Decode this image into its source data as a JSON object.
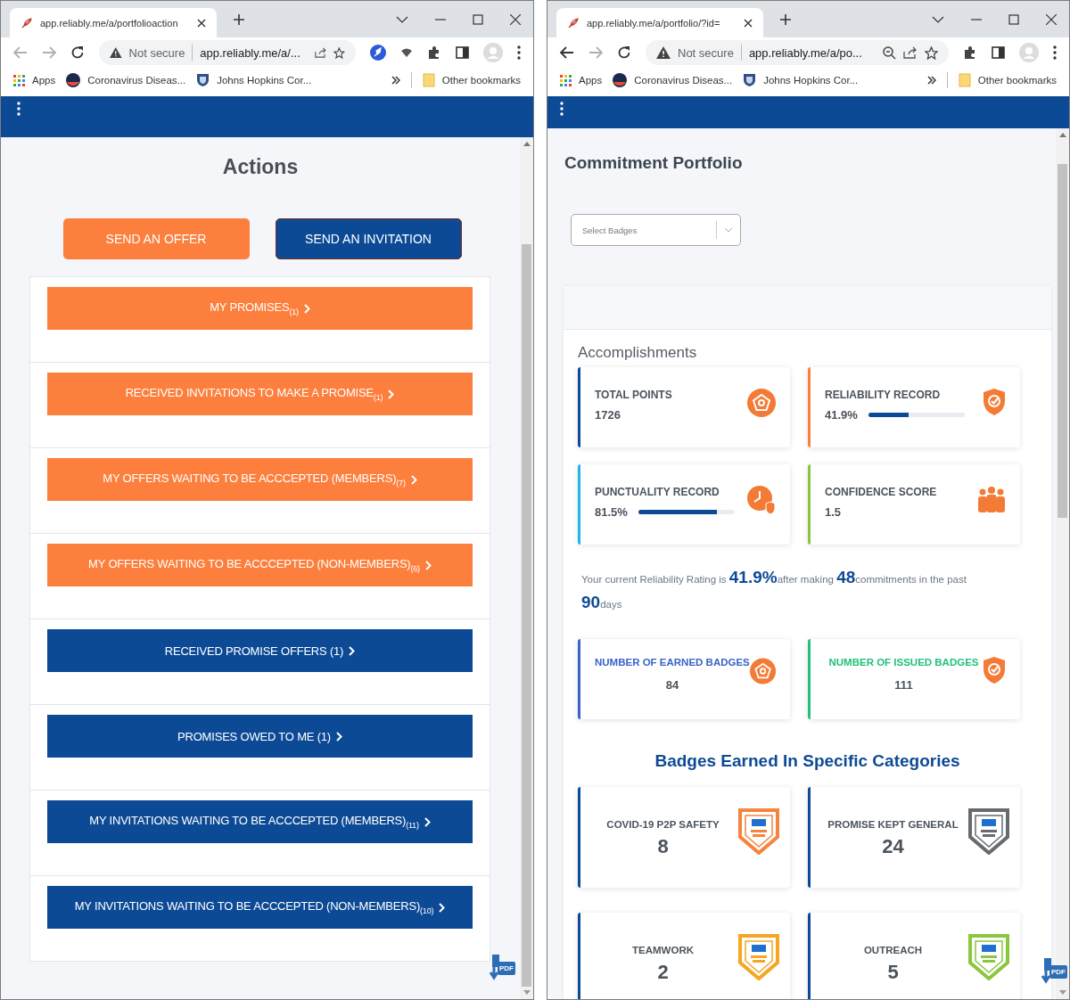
{
  "windows": [
    {
      "kind": "actions",
      "tab_title": "app.reliably.me/a/portfolioaction",
      "back_enabled": false,
      "not_secure": "Not secure",
      "url": "app.reliably.me/a/...",
      "bookmarks": [
        "Apps",
        "Coronavirus Diseas...",
        "Johns Hopkins Cor..."
      ],
      "other_bookmarks": "Other bookmarks",
      "page": {
        "title": "Actions",
        "top_buttons": [
          {
            "label": "SEND AN OFFER",
            "color": "#fd7f3d"
          },
          {
            "label": "SEND AN INVITATION",
            "color": "#0d4a96"
          }
        ],
        "actions": [
          {
            "label": "MY PROMISES$_{(1)}$",
            "color": "#fd7f3d"
          },
          {
            "label": "RECEIVED INVITATIONS TO MAKE A PROMISE$_{(1)}$",
            "color": "#fd7f3d"
          },
          {
            "label": "MY OFFERS WAITING TO BE ACCCEPTED (MEMBERS)$_{(7)}$",
            "color": "#fd7f3d"
          },
          {
            "label": "MY OFFERS WAITING TO BE ACCCEPTED (NON-MEMBERS)$_{(6)}$",
            "color": "#fd7f3d"
          },
          {
            "label": "RECEIVED PROMISE OFFERS (1)",
            "color": "#0d4a96"
          },
          {
            "label": "PROMISES OWED TO ME (1)",
            "color": "#0d4a96"
          },
          {
            "label": "MY INVITATIONS WAITING TO BE ACCCEPTED (MEMBERS)$_{(11)}$",
            "color": "#0d4a96"
          },
          {
            "label": "MY INVITATIONS WAITING TO BE ACCCEPTED (NON-MEMBERS)$_{(10)}$",
            "color": "#0d4a96"
          }
        ],
        "pdf_label": "PDF"
      }
    },
    {
      "kind": "portfolio",
      "tab_title": "app.reliably.me/a/portfolio/?id=",
      "back_enabled": true,
      "not_secure": "Not secure",
      "url": "app.reliably.me/a/po...",
      "bookmarks": [
        "Apps",
        "Coronavirus Diseas...",
        "Johns Hopkins Cor..."
      ],
      "other_bookmarks": "Other bookmarks",
      "page": {
        "title": "Commitment Portfolio",
        "select_placeholder": "Select Badges",
        "section_title": "Accomplishments",
        "stats": [
          {
            "kind": "value",
            "label": "TOTAL POINTS",
            "value": "1726",
            "color": "#0d4a96"
          },
          {
            "kind": "progress",
            "label": "RELIABILITY RECORD",
            "value": "41.9%",
            "level": 0.419,
            "color": "#fd7f3d"
          },
          {
            "kind": "progress",
            "label": "PUNCTUALITY RECORD",
            "value": "81.5%",
            "level": 0.815,
            "color": "#1fb6e0"
          },
          {
            "kind": "value",
            "label": "CONFIDENCE SCORE",
            "value": "1.5",
            "color": "#8bc53f"
          }
        ],
        "rating": "Your current Reliability Rating is **41.9%**after making **48**commitments in the past **90**days",
        "badge_counts": [
          {
            "label": "NUMBER OF EARNED BADGES",
            "value": "84",
            "color": "#3a62c8"
          },
          {
            "label": "NUMBER OF ISSUED BADGES",
            "value": "111",
            "color": "#22c07a"
          }
        ],
        "categories_title": "Badges Earned In Specific Categories",
        "categories": [
          {
            "label": "COVID-19 P2P SAFETY",
            "value": "8",
            "color": "#f5843d"
          },
          {
            "label": "PROMISE KEPT GENERAL",
            "value": "24",
            "color": "#666b70"
          },
          {
            "label": "TEAMWORK",
            "value": "2",
            "color": "#f5a623"
          },
          {
            "label": "OUTREACH",
            "value": "5",
            "color": "#8cc63f"
          }
        ],
        "pdf_label": "PDF"
      }
    }
  ]
}
